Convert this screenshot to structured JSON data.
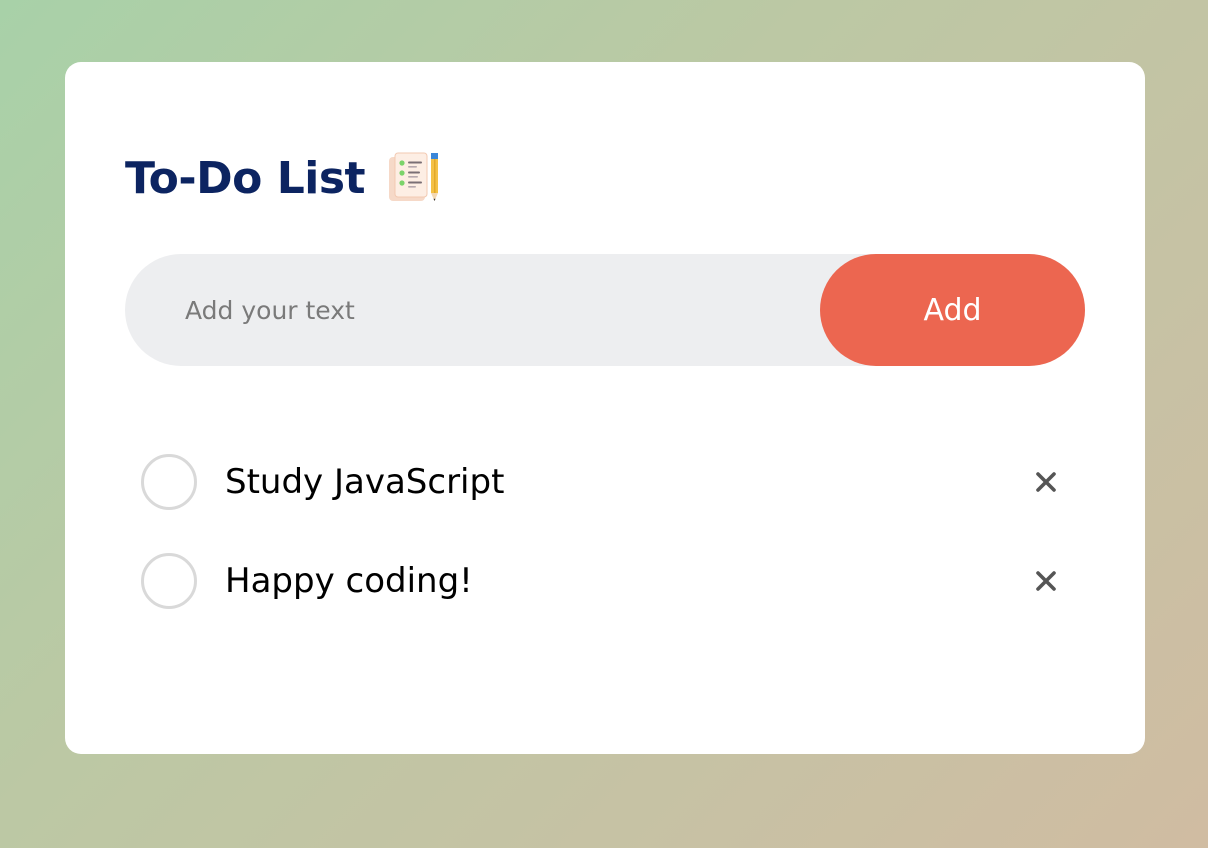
{
  "todo": {
    "title": "To-Do List",
    "title_icon": "notepad-pencil-icon",
    "input": {
      "placeholder": "Add your text",
      "value": ""
    },
    "add_button_label": "Add",
    "tasks": [
      {
        "text": "Study JavaScript",
        "checked": false
      },
      {
        "text": "Happy coding!",
        "checked": false
      }
    ],
    "delete_icon": "close-icon"
  },
  "colors": {
    "title": "#0c2461",
    "accent": "#ec6650",
    "input_background": "#edeef0",
    "checkbox_border": "#d9d9d9",
    "delete_icon": "#555555",
    "card_background": "#ffffff"
  }
}
